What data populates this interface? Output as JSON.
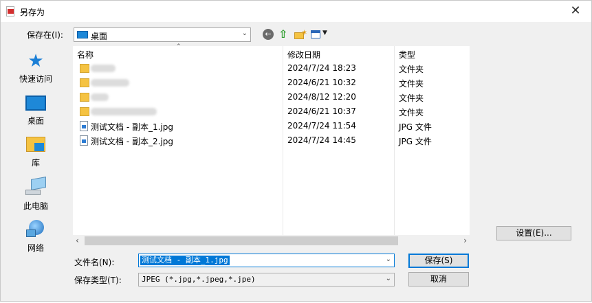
{
  "window": {
    "title": "另存为",
    "close": "✕"
  },
  "toolbar": {
    "save_in_label": "保存在(I):",
    "location": "桌面",
    "back_icon": "back-arrow-icon",
    "up_icon": "up-folder-icon",
    "new_folder_icon": "new-folder-icon",
    "view_icon": "view-menu-icon"
  },
  "places": [
    {
      "label": "快速访问",
      "icon": "star-icon"
    },
    {
      "label": "桌面",
      "icon": "desktop-icon"
    },
    {
      "label": "库",
      "icon": "library-icon"
    },
    {
      "label": "此电脑",
      "icon": "computer-icon"
    },
    {
      "label": "网络",
      "icon": "network-icon"
    }
  ],
  "columns": {
    "name": "名称",
    "date": "修改日期",
    "type": "类型"
  },
  "files": [
    {
      "name": "",
      "date": "2024/7/24 18:23",
      "type": "文件夹",
      "kind": "folder",
      "blur_w": 36
    },
    {
      "name": "",
      "date": "2024/6/21 10:32",
      "type": "文件夹",
      "kind": "folder",
      "blur_w": 56
    },
    {
      "name": "",
      "date": "2024/8/12 12:20",
      "type": "文件夹",
      "kind": "folder",
      "blur_w": 26
    },
    {
      "name": "",
      "date": "2024/6/21 10:37",
      "type": "文件夹",
      "kind": "folder",
      "blur_w": 96
    },
    {
      "name": "测试文档 - 副本_1.jpg",
      "date": "2024/7/24 11:54",
      "type": "JPG 文件",
      "kind": "jpg"
    },
    {
      "name": "测试文档 - 副本_2.jpg",
      "date": "2024/7/24 14:45",
      "type": "JPG 文件",
      "kind": "jpg"
    }
  ],
  "form": {
    "filename_label": "文件名(N):",
    "filename_value": "测试文档 - 副本_1.jpg",
    "filetype_label": "保存类型(T):",
    "filetype_value": "JPEG (*.jpg,*.jpeg,*.jpe)"
  },
  "buttons": {
    "save": "保存(S)",
    "cancel": "取消",
    "settings": "设置(E)..."
  }
}
